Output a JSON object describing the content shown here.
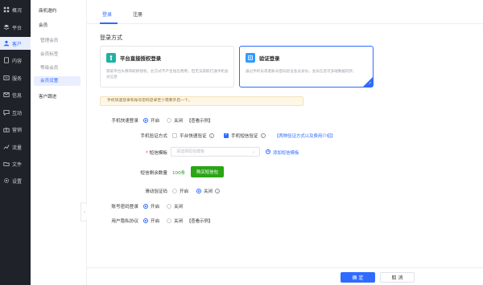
{
  "nav": {
    "items": [
      {
        "label": "概况",
        "icon": "grid-icon"
      },
      {
        "label": "平台",
        "icon": "layers-icon"
      },
      {
        "label": "客户",
        "icon": "user-icon"
      },
      {
        "label": "内容",
        "icon": "document-icon"
      },
      {
        "label": "服务",
        "icon": "service-icon"
      },
      {
        "label": "信息",
        "icon": "message-icon"
      },
      {
        "label": "互动",
        "icon": "chat-icon"
      },
      {
        "label": "营销",
        "icon": "gift-icon"
      },
      {
        "label": "流量",
        "icon": "flow-icon"
      },
      {
        "label": "文件",
        "icon": "folder-icon"
      },
      {
        "label": "设置",
        "icon": "gear-icon"
      }
    ],
    "active_index": 2
  },
  "submenu": {
    "group1": "商机邀约",
    "group2": "会员",
    "children": [
      "管理会员",
      "会员标签",
      "等级会员",
      "会员设置"
    ],
    "selected": "会员设置",
    "group3": "客户跟进"
  },
  "tabs": [
    "登录",
    "注册"
  ],
  "login_method": {
    "title": "登录方式",
    "cards": [
      {
        "title": "平台直接授权登录",
        "desc": "获取平台头像和昵称授权，此方式不产生短信费用，但无法获取打通手机会员信息"
      },
      {
        "title": "验证登录",
        "desc": "通过手机号或者账号密码验证会员身份，会员信息可多端数据同步。"
      }
    ]
  },
  "notice": "手机快速登录和账号密码登录至少需要开启一个。",
  "form": {
    "phone_login": {
      "label": "手机快速登录",
      "on": "开启",
      "off": "关闭",
      "example": "【查看示例】"
    },
    "verify_method": {
      "label": "手机验证方式",
      "opt1": "平台快速验证",
      "opt2": "手机短信验证",
      "link": "【两种验证方式以及费用介绍】"
    },
    "sms_template": {
      "label": "短信模板",
      "placeholder": "请选择短信模板",
      "add": "添加短信模板"
    },
    "sms_remaining": {
      "label": "短信剩余数量",
      "count": "100条",
      "buy": "购买短信包"
    },
    "slider_captcha": {
      "label": "滑动验证码",
      "on": "开启",
      "off": "关闭"
    },
    "account_login": {
      "label": "账号密码登录",
      "on": "开启",
      "off": "关闭"
    },
    "privacy": {
      "label": "用户隐私协议",
      "on": "开启",
      "off": "关闭",
      "example": "【查看示例】"
    }
  },
  "footer": {
    "confirm": "确 定",
    "cancel": "取 消"
  },
  "colors": {
    "accent": "#2f6bff",
    "success": "#2aa515",
    "nav_bg": "#1f2329"
  }
}
